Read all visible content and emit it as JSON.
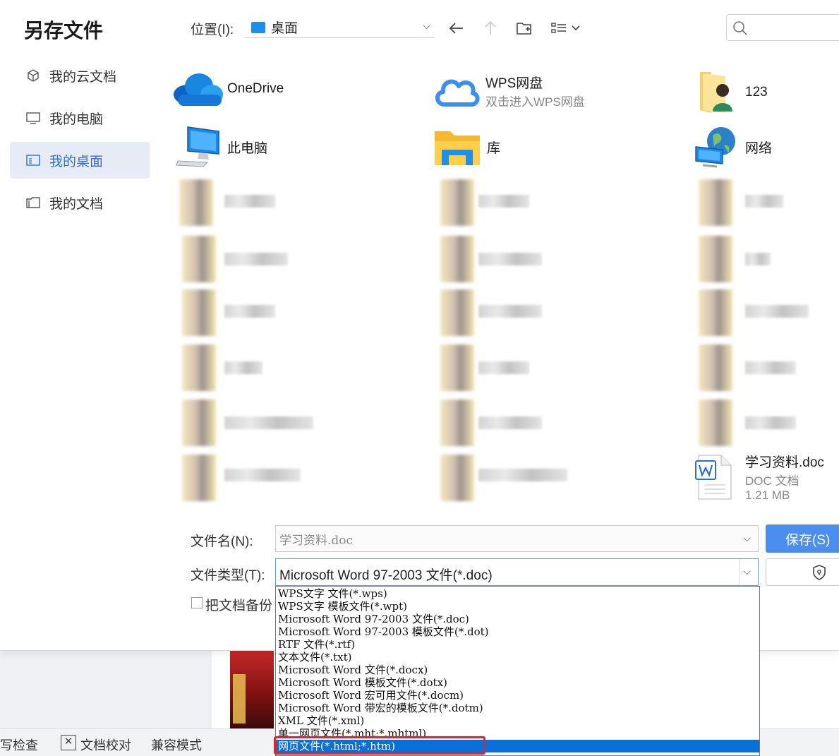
{
  "dialog": {
    "title": "另存文件"
  },
  "sidebar": {
    "items": [
      {
        "label": "我的云文档",
        "icon": "cube-icon"
      },
      {
        "label": "我的电脑",
        "icon": "monitor-icon"
      },
      {
        "label": "我的桌面",
        "icon": "desktop-icon",
        "active": true
      },
      {
        "label": "我的文档",
        "icon": "folder-icon"
      }
    ]
  },
  "toolbar": {
    "location_label": "位置(I):",
    "location_value": "桌面",
    "search_placeholder": ""
  },
  "files": {
    "onedrive": {
      "name": "OneDrive"
    },
    "wps_cloud": {
      "name": "WPS网盘",
      "sub": "双击进入WPS网盘"
    },
    "user_folder": {
      "name": "123"
    },
    "this_pc": {
      "name": "此电脑"
    },
    "library": {
      "name": "库"
    },
    "network": {
      "name": "网络"
    },
    "doc_file": {
      "name": "学习资料.doc",
      "type": "DOC 文档",
      "size": "1.21 MB"
    }
  },
  "form": {
    "filename_label": "文件名(N):",
    "filename_value": "学习资料.doc",
    "filetype_label": "文件类型(T):",
    "filetype_value": "Microsoft Word 97-2003 文件(*.doc)",
    "save_label": "保存(S)",
    "backup_label": "把文档备份"
  },
  "filetype_options": [
    "WPS文字 文件(*.wps)",
    "WPS文字 模板文件(*.wpt)",
    "Microsoft Word 97-2003 文件(*.doc)",
    "Microsoft Word 97-2003 模板文件(*.dot)",
    "RTF 文件(*.rtf)",
    "文本文件(*.txt)",
    "Microsoft Word 文件(*.docx)",
    "Microsoft Word 模板文件(*.dotx)",
    "Microsoft Word 宏可用文件(*.docm)",
    "Microsoft Word 带宏的模板文件(*.dotm)",
    "XML 文件(*.xml)",
    "单一网页文件(*.mht;*.mhtml)",
    "网页文件(*.html;*.htm)"
  ],
  "selected_option_index": 12,
  "statusbar": {
    "spell_check": "写检查",
    "proofread": "文档校对",
    "compat_mode": "兼容模式"
  },
  "colors": {
    "accent": "#4a8ef0",
    "selection": "#0a6fd6",
    "highlight_box": "#e0242b",
    "sidebar_active_bg": "#e6ebf5"
  }
}
